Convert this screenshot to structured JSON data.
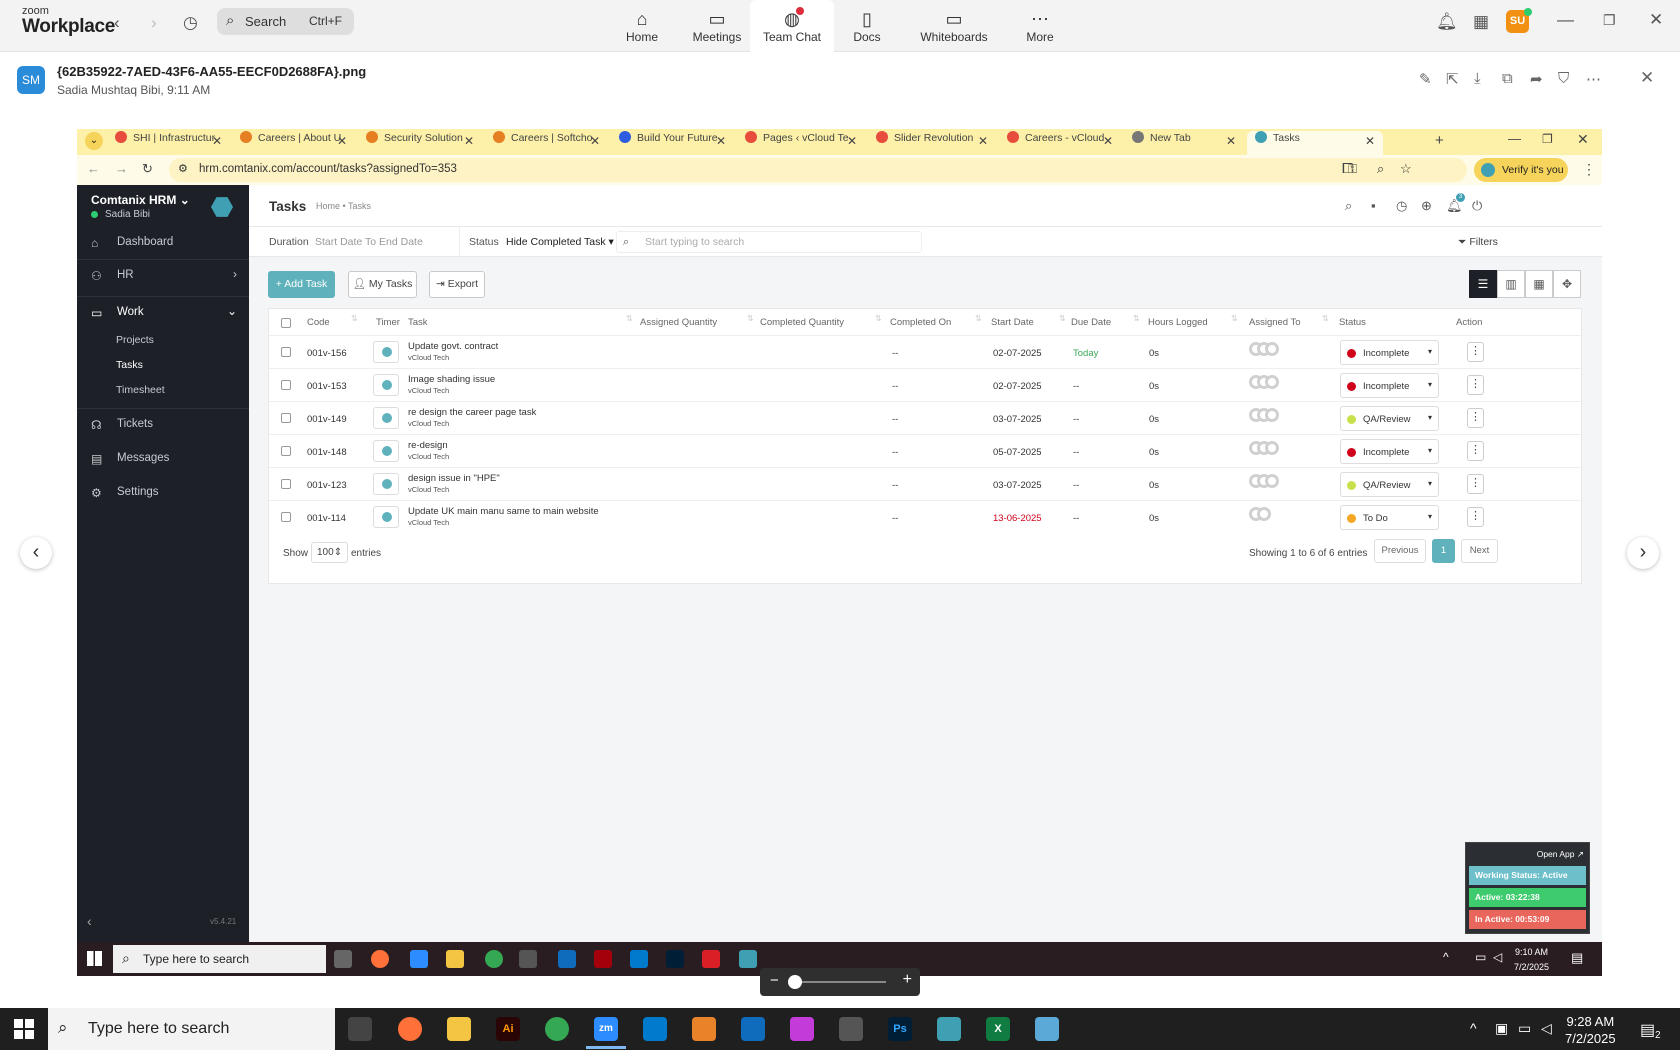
{
  "zoom": {
    "brand_small": "zoom",
    "brand_big": "Workplace",
    "search_label": "Search",
    "search_shortcut": "Ctrl+F",
    "tabs": [
      {
        "label": "Home",
        "icon": "home-icon"
      },
      {
        "label": "Meetings",
        "icon": "video-icon"
      },
      {
        "label": "Team Chat",
        "icon": "chat-icon"
      },
      {
        "label": "Docs",
        "icon": "doc-icon"
      },
      {
        "label": "Whiteboards",
        "icon": "whiteboard-icon"
      },
      {
        "label": "More",
        "icon": "more-icon"
      }
    ],
    "active_tab": "Team Chat",
    "user_initials": "SU"
  },
  "file": {
    "avatar": "SM",
    "name": "{62B35922-7AED-43F6-AA55-EECF0D2688FA}.png",
    "meta": "Sadia Mushtaq Bibi, 9:11 AM"
  },
  "browser": {
    "tabs": [
      {
        "label": "SHI | Infrastructur",
        "color": "#e74c3c"
      },
      {
        "label": "Careers | About U",
        "color": "#e67e22"
      },
      {
        "label": "Security Solution",
        "color": "#e67e22"
      },
      {
        "label": "Careers | Softcho",
        "color": "#e67e22"
      },
      {
        "label": "Build Your Future",
        "color": "#2c5ce0"
      },
      {
        "label": "Pages ‹ vCloud Te",
        "color": "#e74c3c"
      },
      {
        "label": "Slider Revolution",
        "color": "#e74c3c"
      },
      {
        "label": "Careers - vCloud",
        "color": "#e74c3c"
      },
      {
        "label": "New Tab",
        "color": "#777777"
      },
      {
        "label": "Tasks",
        "color": "#3fa0b4"
      }
    ],
    "url": "hrm.comtanix.com/account/tasks?assignedTo=353",
    "verify": "Verify it's you"
  },
  "sidebar": {
    "brand": "Comtanix HRM",
    "user": "Sadia Bibi",
    "items": [
      {
        "label": "Dashboard",
        "icon": "dashboard-icon"
      },
      {
        "label": "HR",
        "icon": "people-icon"
      },
      {
        "label": "Work",
        "icon": "briefcase-icon"
      }
    ],
    "work_sub": [
      "Projects",
      "Tasks",
      "Timesheet"
    ],
    "items2": [
      {
        "label": "Tickets",
        "icon": "headset-icon"
      },
      {
        "label": "Messages",
        "icon": "message-icon"
      },
      {
        "label": "Settings",
        "icon": "gear-icon"
      }
    ],
    "version": "v5.4.21"
  },
  "page": {
    "title": "Tasks",
    "breadcrumb": "Home • Tasks",
    "duration_label": "Duration",
    "duration_placeholder": "Start Date To End Date",
    "status_label": "Status",
    "status_value": "Hide Completed Task",
    "search_placeholder": "Start typing to search",
    "filters": "Filters",
    "add_task": "Add Task",
    "my_tasks": "My Tasks",
    "export": "Export"
  },
  "table": {
    "headers": [
      "Code",
      "Timer",
      "Task",
      "Assigned Quantity",
      "Completed Quantity",
      "Completed On",
      "Start Date",
      "Due Date",
      "Hours Logged",
      "Assigned To",
      "Status",
      "Action"
    ],
    "rows": [
      {
        "code": "001v-156",
        "task": "Update govt. contract",
        "client": "vCloud Tech",
        "completed_on": "--",
        "start": "02-07-2025",
        "due": "Today",
        "due_color": "#3aa757",
        "start_color": "#333333",
        "hours": "0s",
        "assignees": 3,
        "status": "Incomplete",
        "status_color": "#d0021b"
      },
      {
        "code": "001v-153",
        "task": "Image shading issue",
        "client": "vCloud Tech",
        "completed_on": "--",
        "start": "02-07-2025",
        "due": "--",
        "due_color": "#333333",
        "start_color": "#333333",
        "hours": "0s",
        "assignees": 3,
        "status": "Incomplete",
        "status_color": "#d0021b"
      },
      {
        "code": "001v-149",
        "task": "re design the career page task",
        "client": "vCloud Tech",
        "completed_on": "--",
        "start": "03-07-2025",
        "due": "--",
        "due_color": "#333333",
        "start_color": "#333333",
        "hours": "0s",
        "assignees": 3,
        "status": "QA/Review",
        "status_color": "#c8e04a"
      },
      {
        "code": "001v-148",
        "task": "re-design",
        "client": "vCloud Tech",
        "completed_on": "--",
        "start": "05-07-2025",
        "due": "--",
        "due_color": "#333333",
        "start_color": "#333333",
        "hours": "0s",
        "assignees": 3,
        "status": "Incomplete",
        "status_color": "#d0021b"
      },
      {
        "code": "001v-123",
        "task": "design issue in \"HPE\"",
        "client": "vCloud Tech",
        "completed_on": "--",
        "start": "03-07-2025",
        "due": "--",
        "due_color": "#333333",
        "start_color": "#333333",
        "hours": "0s",
        "assignees": 3,
        "status": "QA/Review",
        "status_color": "#c8e04a"
      },
      {
        "code": "001v-114",
        "task": "Update UK main manu same to main website",
        "client": "vCloud Tech",
        "completed_on": "--",
        "start": "13-06-2025",
        "due": "--",
        "due_color": "#333333",
        "start_color": "#d0021b",
        "hours": "0s",
        "assignees": 2,
        "status": "To Do",
        "status_color": "#f5a623"
      }
    ],
    "show": "Show",
    "show_value": "100",
    "entries": "entries",
    "summary": "Showing 1 to 6 of 6 entries",
    "previous": "Previous",
    "current_page": "1",
    "next": "Next"
  },
  "widget": {
    "open_app": "Open App ↗",
    "working": "Working Status: Active",
    "active": "Active: 03:22:38",
    "inactive": "In Active: 00:53:09"
  },
  "inner_taskbar": {
    "search": "Type here to search",
    "time": "9:10 AM",
    "date": "7/2/2025"
  },
  "taskbar": {
    "search": "Type here to search",
    "time": "9:28 AM",
    "date": "7/2/2025",
    "notif_count": "2"
  }
}
